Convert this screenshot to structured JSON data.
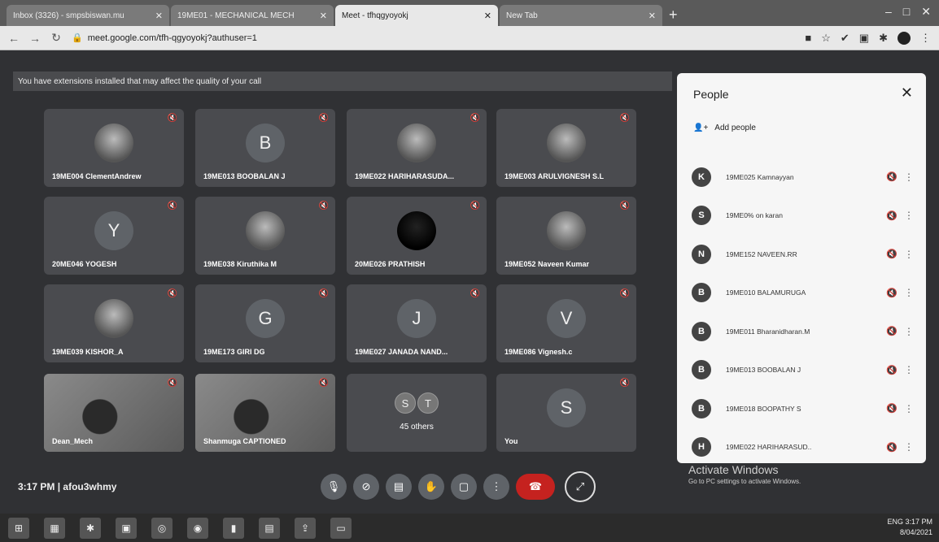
{
  "browser": {
    "tabs": [
      {
        "label": "Inbox (3326) - smpsbiswan.mu",
        "active": false
      },
      {
        "label": "19ME01 - MECHANICAL MECH",
        "active": false
      },
      {
        "label": "Meet - tfhqgyoyokj",
        "active": true
      },
      {
        "label": "New Tab",
        "active": false
      }
    ],
    "url": "meet.google.com/tfh-qgyoyokj?authuser=1"
  },
  "meet": {
    "warning": "You have extensions installed that may affect the quality of your call",
    "tiles": [
      {
        "name": "19ME004 ClementAndrew",
        "kind": "photo",
        "initial": ""
      },
      {
        "name": "19ME013 BOOBALAN J",
        "kind": "initial",
        "initial": "B"
      },
      {
        "name": "19ME022 HARIHARASUDA...",
        "kind": "photo",
        "initial": ""
      },
      {
        "name": "19ME003 ARULVIGNESH S.L",
        "kind": "photo",
        "initial": ""
      },
      {
        "name": "20ME046 YOGESH",
        "kind": "initial",
        "initial": "Y"
      },
      {
        "name": "19ME038 Kiruthika M",
        "kind": "photo",
        "initial": ""
      },
      {
        "name": "20ME026 PRATHISH",
        "kind": "dark",
        "initial": ""
      },
      {
        "name": "19ME052 Naveen Kumar",
        "kind": "photo",
        "initial": ""
      },
      {
        "name": "19ME039 KISHOR_A",
        "kind": "photo",
        "initial": ""
      },
      {
        "name": "19ME173 GIRI DG",
        "kind": "initial",
        "initial": "G"
      },
      {
        "name": "19ME027 JANADA NAND...",
        "kind": "initial",
        "initial": "J"
      },
      {
        "name": "19ME086 Vignesh.c",
        "kind": "initial",
        "initial": "V"
      },
      {
        "name": "Dean_Mech",
        "kind": "video",
        "initial": ""
      },
      {
        "name": "Shanmuga CAPTIONED",
        "kind": "video",
        "initial": ""
      },
      {
        "name": "45 others",
        "kind": "others",
        "initial": ""
      },
      {
        "name": "You",
        "kind": "initial",
        "initial": "S"
      }
    ],
    "others_initials": [
      "S",
      "T"
    ],
    "clock": "3:17 PM",
    "separator": "|",
    "meeting_code": "afou3whmy",
    "activate_title": "Activate Windows",
    "activate_sub": "Go to PC settings to activate Windows."
  },
  "people": {
    "title": "People",
    "add_label": "Add people",
    "members": [
      {
        "name": "19ME025 Kamnayyan",
        "initial": "K"
      },
      {
        "name": "19ME0% on karan",
        "initial": "S"
      },
      {
        "name": "19ME152 NAVEEN.RR",
        "initial": "N"
      },
      {
        "name": "19ME010 BALAMURUGA",
        "initial": "B"
      },
      {
        "name": "19ME011 Bharanidharan.M",
        "initial": "B"
      },
      {
        "name": "19ME013 BOOBALAN J",
        "initial": "B"
      },
      {
        "name": "19ME018 BOOPATHY S",
        "initial": "B"
      },
      {
        "name": "19ME022 HARIHARASUD..",
        "initial": "H"
      }
    ]
  },
  "taskbar": {
    "time": "3:17 PM",
    "date": "8/04/2021",
    "lang": "ENG"
  }
}
